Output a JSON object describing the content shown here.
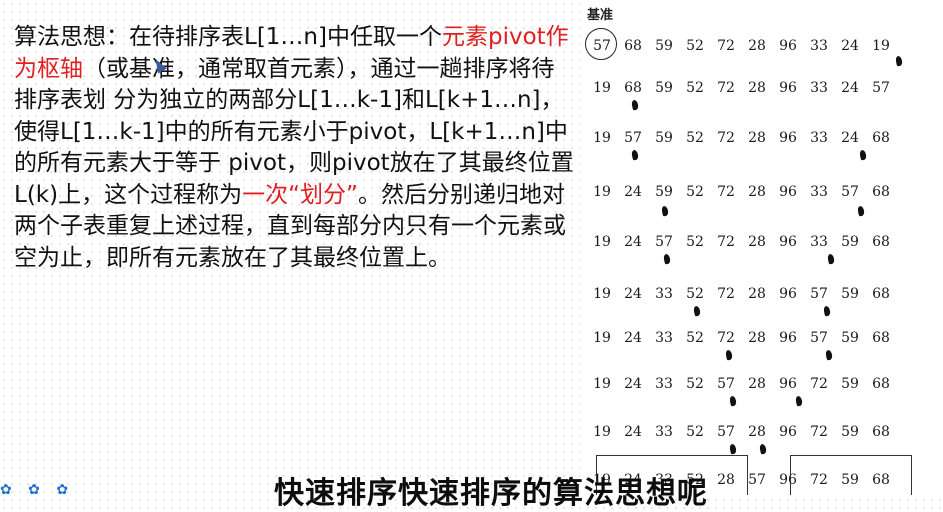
{
  "algorithm_text": {
    "seg1": "算法思想：在待排序表L[1…n]中任取一个",
    "seg2": "元素pivot作为枢轴",
    "seg3": "（或基准，通常取首元素），通过一趟排序将待排序表划 分为独立的两部分L[1…k-1]和L[k+1…n]，使得L[1…k-1]中的所有元素小于pivot，L[k+1…n]中的所有元素大于等于 pivot，则pivot放在了其最终位置L(k)上，这个过程称为",
    "seg4": "一次“划分”",
    "seg5": "。然后分别递归地对两个子表重复上述过程，直到每部分内只有一个元素或空为止，即所有元素放在了其最终位置上。"
  },
  "diagram": {
    "base_label": "基准",
    "rows": [
      [
        "57",
        "68",
        "59",
        "52",
        "72",
        "28",
        "96",
        "33",
        "24",
        "19"
      ],
      [
        "19",
        "68",
        "59",
        "52",
        "72",
        "28",
        "96",
        "33",
        "24",
        "57"
      ],
      [
        "19",
        "57",
        "59",
        "52",
        "72",
        "28",
        "96",
        "33",
        "24",
        "68"
      ],
      [
        "19",
        "24",
        "59",
        "52",
        "72",
        "28",
        "96",
        "33",
        "57",
        "68"
      ],
      [
        "19",
        "24",
        "57",
        "52",
        "72",
        "28",
        "96",
        "33",
        "59",
        "68"
      ],
      [
        "19",
        "24",
        "33",
        "52",
        "72",
        "28",
        "96",
        "57",
        "59",
        "68"
      ],
      [
        "19",
        "24",
        "33",
        "52",
        "72",
        "28",
        "96",
        "57",
        "59",
        "68"
      ],
      [
        "19",
        "24",
        "33",
        "52",
        "57",
        "28",
        "96",
        "72",
        "59",
        "68"
      ],
      [
        "19",
        "24",
        "33",
        "52",
        "57",
        "28",
        "96",
        "72",
        "59",
        "68"
      ],
      [
        "19",
        "24",
        "33",
        "52",
        "28",
        "57",
        "96",
        "72",
        "59",
        "68"
      ]
    ]
  },
  "subtitle": "快速排序快速排序的算法思想呢",
  "decoration": "✿ ✿ ✿"
}
